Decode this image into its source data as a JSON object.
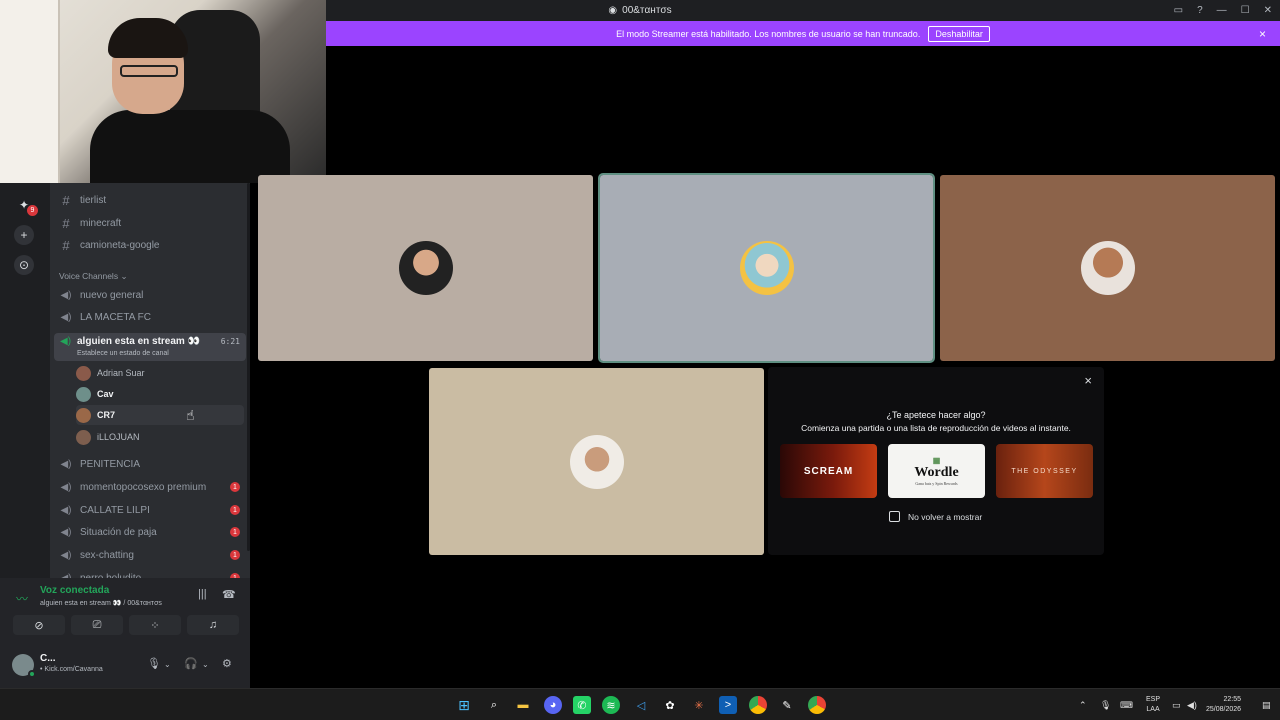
{
  "window": {
    "title": "00&raquo;тωтσs",
    "title_display": "00&тαнтσѕ"
  },
  "banner": {
    "message": "El modo Streamer está habilitado. Los nombres de usuario se han truncado.",
    "button": "Deshabilitar",
    "close": "×"
  },
  "sidebar": {
    "text_channels": [
      "tierlist",
      "minecraft",
      "camioneta-google"
    ],
    "voice_category": "Voice Channels",
    "voice_channels_top": [
      "nuevo general",
      "LA MACETA FC"
    ],
    "active_channel": {
      "name": "alguien esta en stream 👀",
      "status": "Establece un estado de canal",
      "timer": "6:21"
    },
    "voice_users": [
      "Adrian Suar",
      "Cav",
      "CR7",
      "iLLOJUAN"
    ],
    "voice_channels_bottom": [
      {
        "name": "PENITENCIA",
        "badge": ""
      },
      {
        "name": "momentopocosexo premium",
        "badge": "1"
      },
      {
        "name": "CALLATE LILPI",
        "badge": "1"
      },
      {
        "name": "Situación de paja",
        "badge": "1"
      },
      {
        "name": "sex-chatting",
        "badge": "1"
      },
      {
        "name": "perro boludito",
        "badge": "1"
      }
    ]
  },
  "rail": {
    "badge": "9"
  },
  "panel": {
    "voice_status": "Voz conectada",
    "voice_sub": "alguien esta en stream 👀 / 00&тαнтσѕ",
    "user_name": "C...",
    "user_sub": "• Kick.com/Cavanna"
  },
  "activity": {
    "title": "¿Te apetece hacer algo?",
    "subtitle": "Comienza una partida o una lista de reproducción de videos al instante.",
    "cards": [
      "SCREAM",
      "Wordle",
      "THE ODYSSEY"
    ],
    "wordle_sub": "Gana bats y Spin Rewards",
    "checkbox_label": "No volver a mostrar",
    "close": "×"
  },
  "taskbar": {
    "lang_top": "ESP",
    "lang_bottom": "LAA",
    "time": "22:55",
    "date": "25/08/2026"
  },
  "colors": {
    "banner": "#9b44ff",
    "tile1": "#b9ada3",
    "tile2": "#a8adb5",
    "tile3": "#8c634a",
    "tile4": "#cabca3",
    "online": "#23a55a",
    "badge": "#da373c"
  }
}
